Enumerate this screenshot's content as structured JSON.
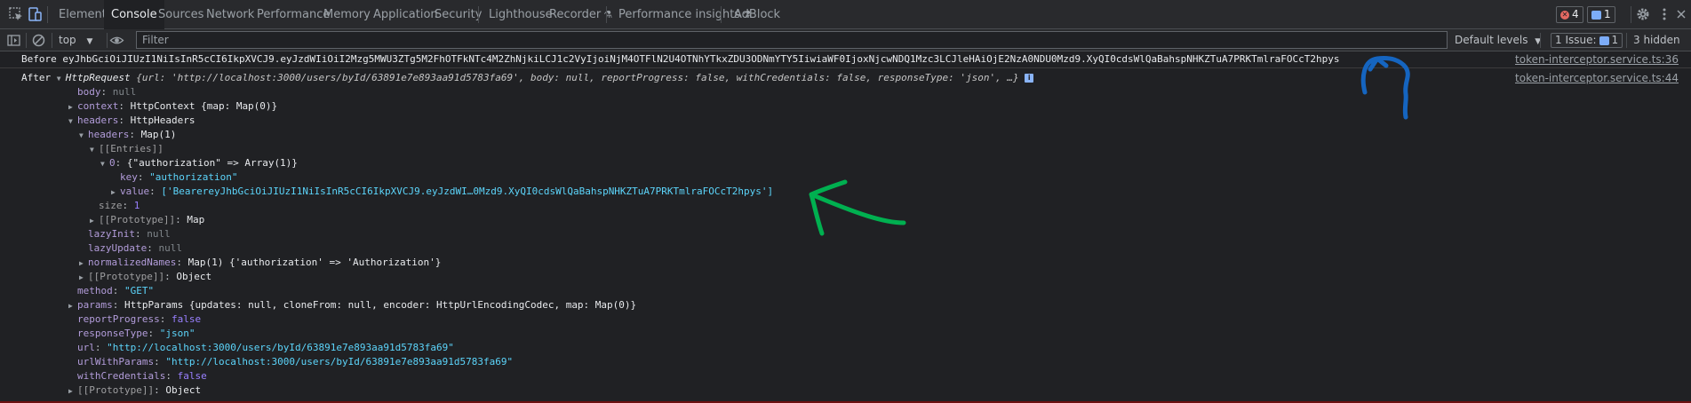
{
  "tabs": {
    "items": [
      "Elements",
      "Console",
      "Sources",
      "Network",
      "Performance",
      "Memory",
      "Application",
      "Security",
      "Lighthouse",
      "Recorder",
      "Performance insights",
      "AdBlock"
    ],
    "active": "Console"
  },
  "status": {
    "error_count": "4",
    "message_count": "1"
  },
  "toolbar": {
    "context": "top",
    "filter_placeholder": "Filter",
    "levels": "Default levels",
    "issues_label": "1 Issue:",
    "issues_count": "1",
    "hidden": "3 hidden"
  },
  "log1": {
    "label": "Before",
    "token": "eyJhbGciOiJIUzI1NiIsInR5cCI6IkpXVCJ9.eyJzdWIiOiI2Mzg5MWU3ZTg5M2FhOTFkNTc4M2ZhNjkiLCJ1c2VyIjoiNjM4OTFlN2U4OTNhYTkxZDU3ODNmYTY5IiwiaWF0IjoxNjcwNDQ1Mzc3LCJleHAiOjE2NzA0NDU0Mzd9.XyQI0cdsWlQaBahspNHKZTuA7PRKTmlraFOCcT2hpys",
    "source": "token-interceptor.service.ts:36"
  },
  "log2": {
    "label": "After",
    "source": "token-interceptor.service.ts:44",
    "summary_class": "HttpRequest",
    "summary_rest": "{url: 'http://localhost:3000/users/byId/63891e7e893aa91d5783fa69', body: null, reportProgress: false, withCredentials: false, responseType: 'json', …}",
    "info_badge": "i"
  },
  "tree": {
    "body": [
      "body",
      "null"
    ],
    "context": [
      "context",
      "HttpContext {map: Map(0)}"
    ],
    "headers": [
      "headers",
      "HttpHeaders"
    ],
    "headers_inner": [
      "headers",
      "Map(1)"
    ],
    "entries": "[[Entries]]",
    "entry0": [
      "0",
      "{\"authorization\" => Array(1)}"
    ],
    "entry_key": [
      "key",
      "\"authorization\""
    ],
    "entry_value": [
      "value",
      "['BearereyJhbGciOiJIUzI1NiIsInR5cCI6IkpXVCJ9.eyJzdWI…0Mzd9.XyQI0cdsWlQaBahspNHKZTuA7PRKTmlraFOCcT2hpys']"
    ],
    "size": [
      "size",
      "1"
    ],
    "prototype_map": [
      "[[Prototype]]",
      "Map"
    ],
    "lazyInit": [
      "lazyInit",
      "null"
    ],
    "lazyUpdate": [
      "lazyUpdate",
      "null"
    ],
    "normalizedNames": [
      "normalizedNames",
      "Map(1) {'authorization' => 'Authorization'}"
    ],
    "prototype_obj1": [
      "[[Prototype]]",
      "Object"
    ],
    "method": [
      "method",
      "\"GET\""
    ],
    "params": [
      "params",
      "HttpParams {updates: null, cloneFrom: null, encoder: HttpUrlEncodingCodec, map: Map(0)}"
    ],
    "reportProgress": [
      "reportProgress",
      "false"
    ],
    "responseType": [
      "responseType",
      "\"json\""
    ],
    "url": [
      "url",
      "\"http://localhost:3000/users/byId/63891e7e893aa91d5783fa69\""
    ],
    "urlWithParams": [
      "urlWithParams",
      "\"http://localhost:3000/users/byId/63891e7e893aa91d5783fa69\""
    ],
    "withCredentials": [
      "withCredentials",
      "false"
    ],
    "prototype_obj2": [
      "[[Prototype]]",
      "Object"
    ]
  },
  "colors": {
    "annotation_blue": "#1565c0",
    "annotation_green": "#00b050"
  }
}
